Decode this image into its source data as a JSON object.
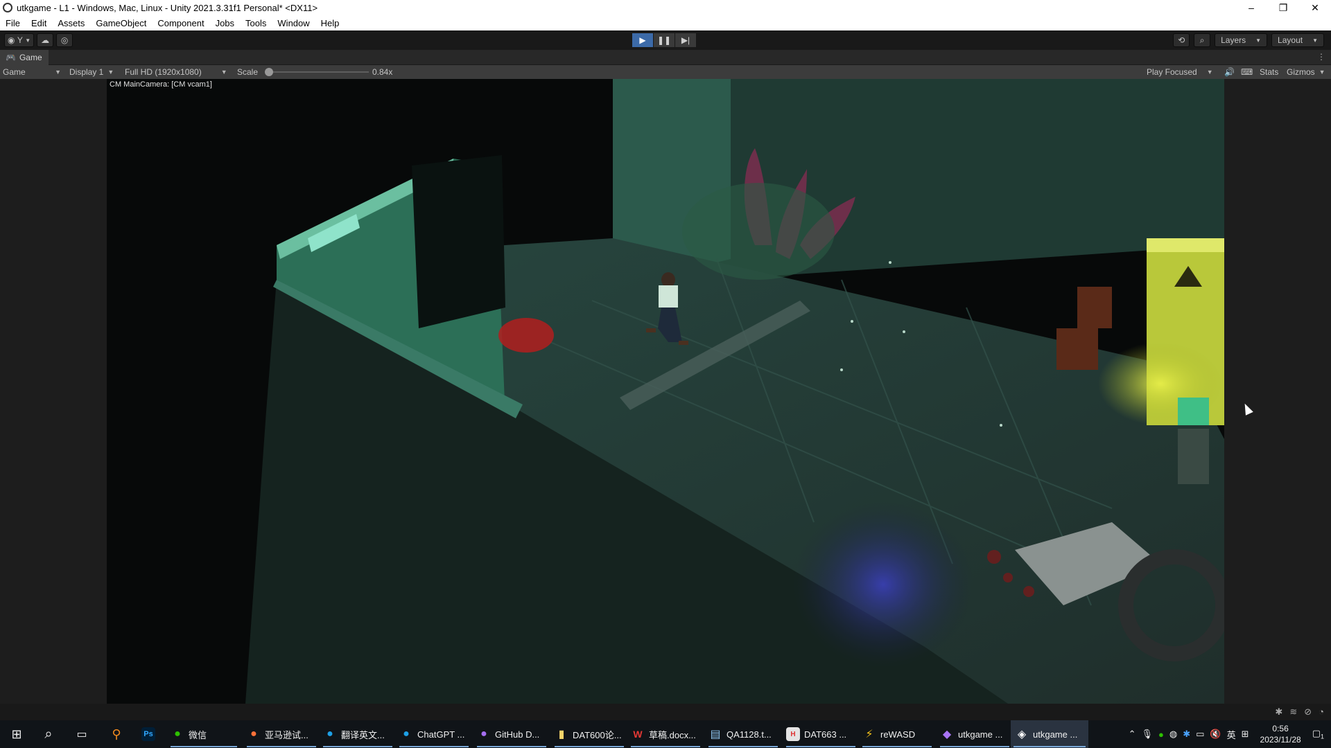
{
  "window": {
    "title": "utkgame - L1 - Windows, Mac, Linux - Unity 2021.3.31f1 Personal* <DX11>",
    "controls": {
      "minimize": "–",
      "restore": "❐",
      "close": "✕"
    }
  },
  "menu": [
    "File",
    "Edit",
    "Assets",
    "GameObject",
    "Component",
    "Jobs",
    "Tools",
    "Window",
    "Help"
  ],
  "toolbar": {
    "account_label": "Y",
    "play_icon": "▶",
    "pause_icon": "❚❚",
    "step_icon": "▶|",
    "layers_label": "Layers",
    "layout_label": "Layout"
  },
  "tab": {
    "label": "Game"
  },
  "gamebar": {
    "mode": "Game",
    "display": "Display 1",
    "resolution": "Full HD (1920x1080)",
    "scale_label": "Scale",
    "scale_value": "0.84x",
    "scale_fraction": 0.0,
    "play_focused": "Play Focused",
    "stats": "Stats",
    "gizmos": "Gizmos"
  },
  "camera_label": "CM MainCamera: [CM vcam1]",
  "taskbar": {
    "apps": [
      {
        "label": "",
        "icon": "windows-start-icon"
      },
      {
        "label": "",
        "icon": "search-icon"
      },
      {
        "label": "",
        "icon": "task-view-icon"
      },
      {
        "label": "",
        "icon": "magnifier-app-icon"
      },
      {
        "label": "",
        "icon": "photoshop-icon"
      },
      {
        "label": "微信",
        "icon": "wechat-icon"
      },
      {
        "label": "亚马逊试...",
        "icon": "firefox-icon"
      },
      {
        "label": "翻译英文...",
        "icon": "edge-icon"
      },
      {
        "label": "ChatGPT ...",
        "icon": "edge-icon"
      },
      {
        "label": "GitHub D...",
        "icon": "github-icon"
      },
      {
        "label": "DAT600论...",
        "icon": "file-icon"
      },
      {
        "label": "草稿.docx...",
        "icon": "wps-icon"
      },
      {
        "label": "QA1128.t...",
        "icon": "notepad-icon"
      },
      {
        "label": "DAT663 ...",
        "icon": "html-icon"
      },
      {
        "label": "reWASD",
        "icon": "rewasd-icon"
      },
      {
        "label": "utkgame ...",
        "icon": "visual-studio-icon"
      },
      {
        "label": "utkgame ...",
        "icon": "unity-icon"
      }
    ],
    "ime": "英",
    "time": "0:56",
    "date": "2023/11/28",
    "notifications": "1"
  }
}
